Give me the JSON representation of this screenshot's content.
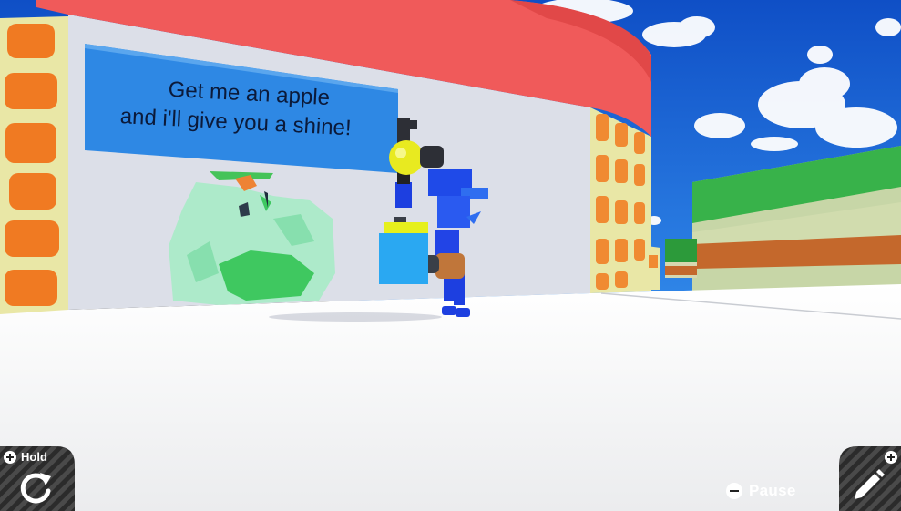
{
  "sign": {
    "line1": "Get me an apple",
    "line2": "and i'll give you a shine!"
  },
  "hud": {
    "hold_label": "Hold",
    "pause_label": "Pause",
    "hold_button_icon": "rotate-icon",
    "edit_button_icon": "pencil-icon",
    "pause_button_icon": "minus-button-icon"
  },
  "colors": {
    "sky": "#1f66d8",
    "wall_red": "#f05a5a",
    "floor": "#f2f3f4",
    "sign": "#2f86e0",
    "character_blue": "#1d3fe0",
    "hud_stripes": "#3a3a3a"
  }
}
